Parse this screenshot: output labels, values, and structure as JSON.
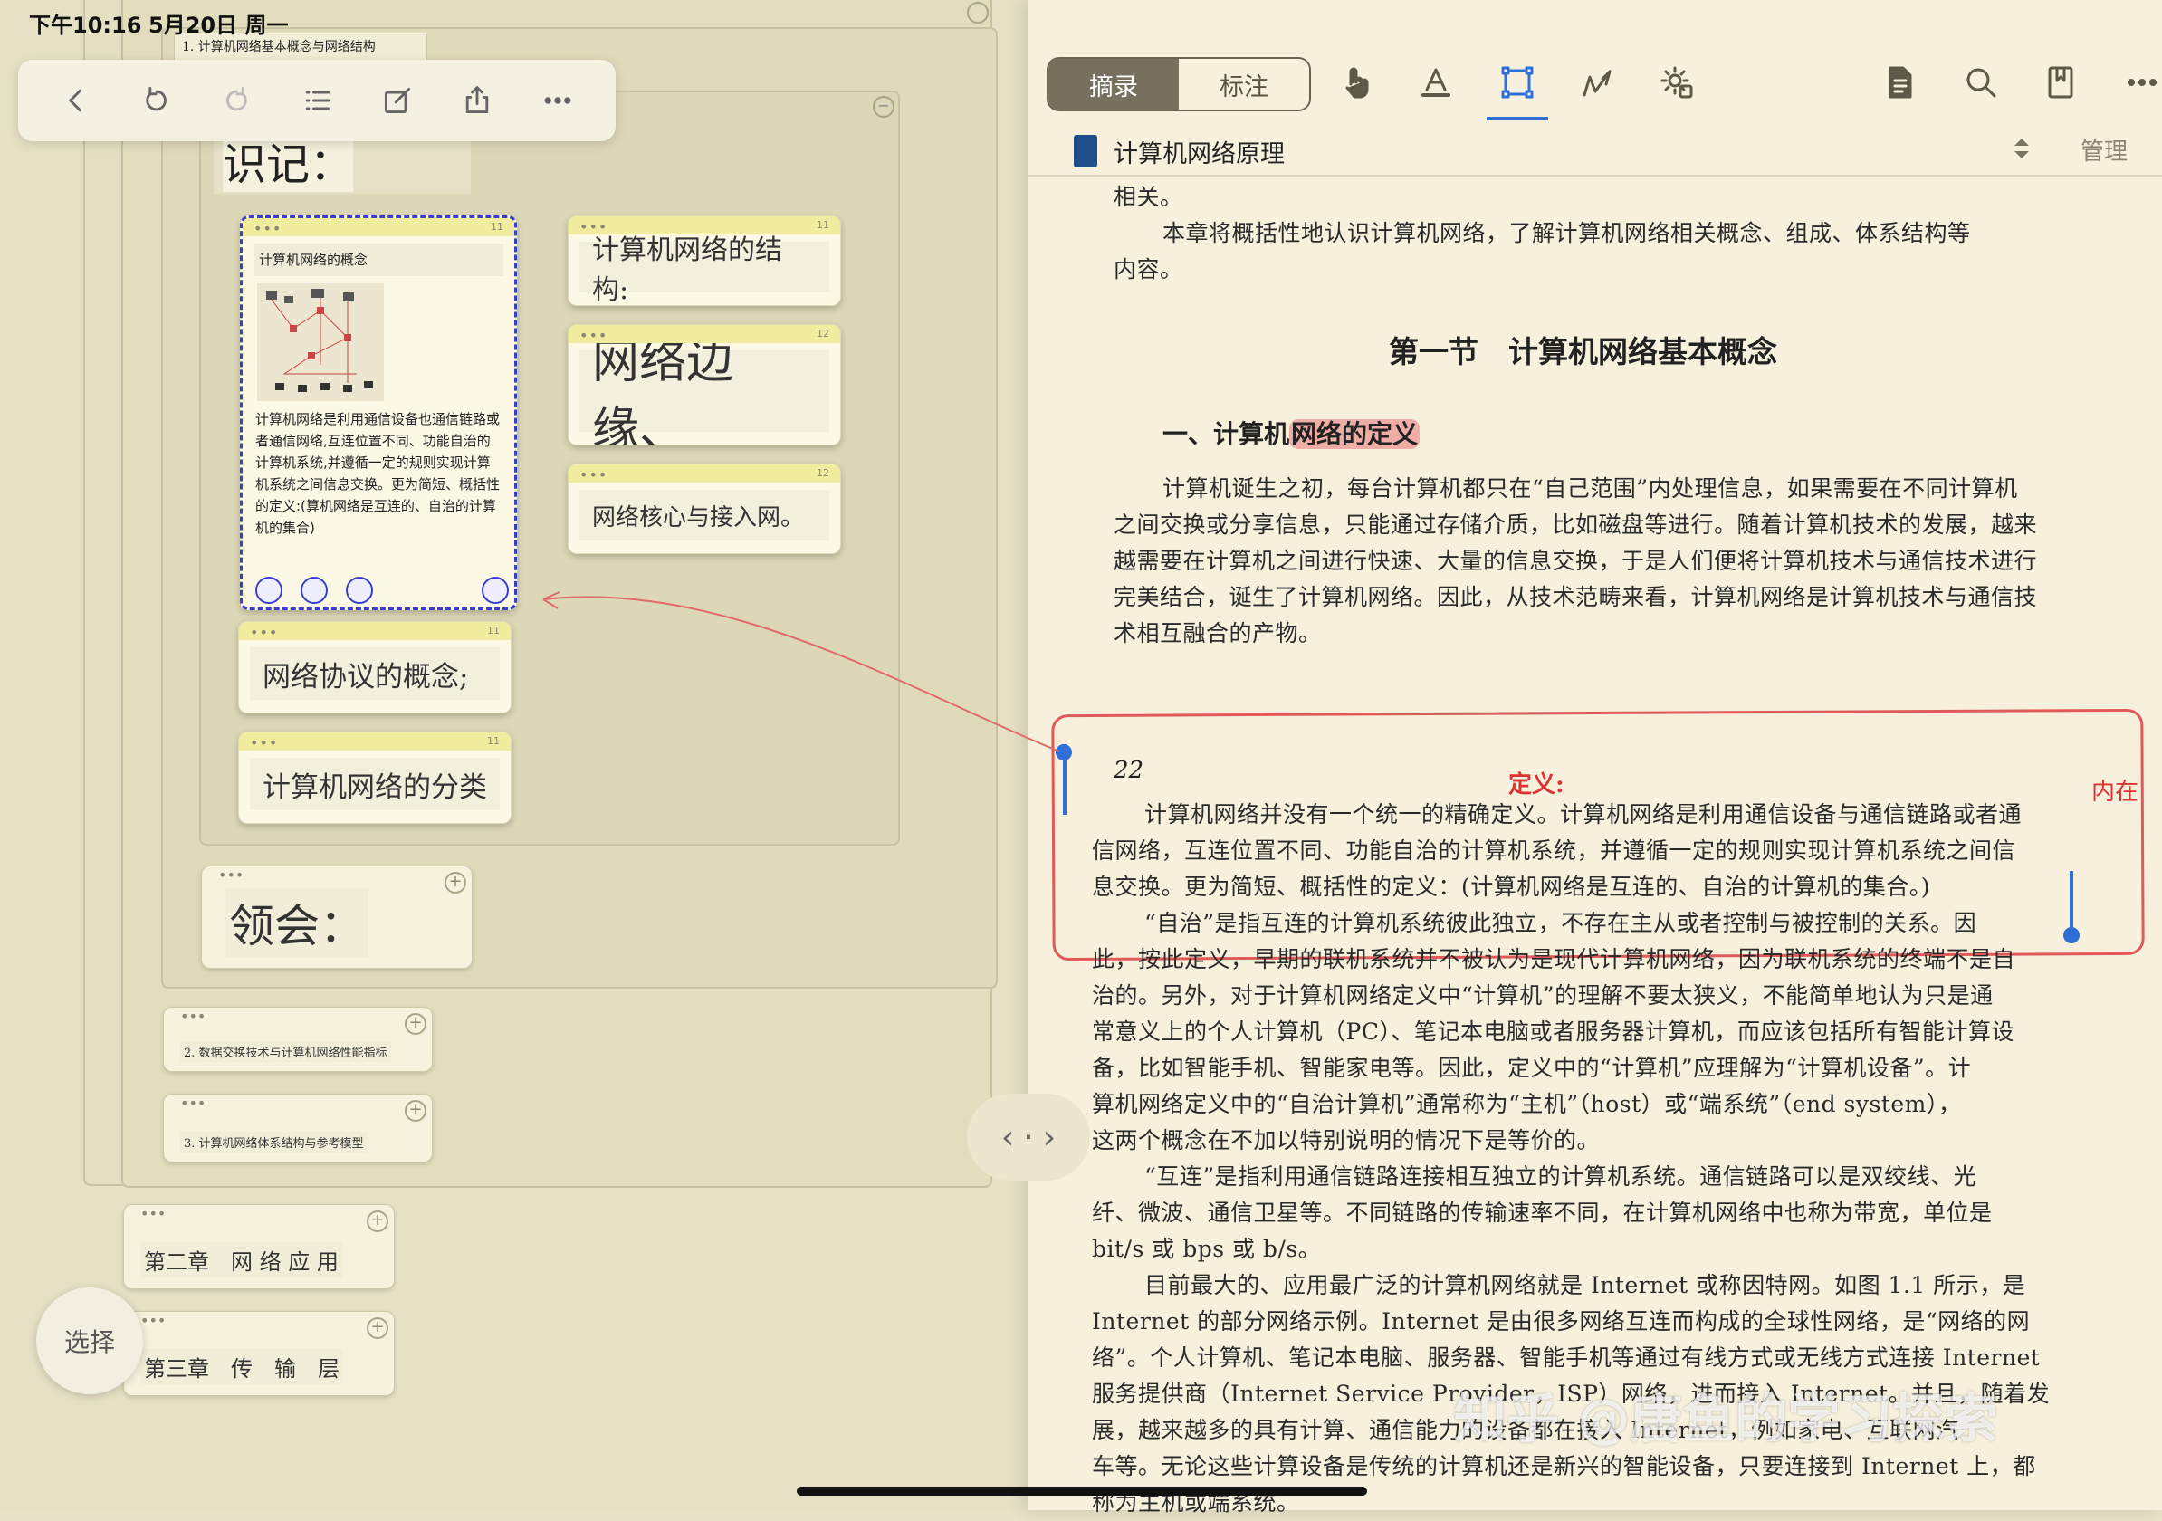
{
  "status_bar": {
    "time": "下午10:16",
    "date": "5月20日 周一"
  },
  "left": {
    "top_node": "1. 计算机网络基本概念与网络结构",
    "shiji_label": "识记：",
    "lingui_label": "领会：",
    "cards": {
      "concept": {
        "title": "计算机网络的概念",
        "count": "11",
        "body": "计算机网络是利用通信设备也通信链路或者通信网络,互连位置不同、功能自治的计算机系统,并遵循一定的规则实现计算机系统之间信息交换。更为简短、概括性的定义:(算机网络是互连的、自治的计算机的集合)"
      },
      "structure": {
        "text": "计算机网络的结构:",
        "count": "11"
      },
      "edge": {
        "text": "网络边缘、",
        "count": "12"
      },
      "core": {
        "text": "网络核心与接入网。",
        "count": "12"
      },
      "protocol": {
        "text": "网络协议的概念;",
        "count": "11"
      },
      "classify": {
        "text": "计算机网络的分类",
        "count": "11"
      }
    },
    "subnodes": {
      "n2": "2. 数据交换技术与计算机网络性能指标",
      "n3": "3. 计算机网络体系结构与参考模型"
    },
    "chapters": {
      "ch2": "第二章　网 络 应 用",
      "ch3": "第三章　传　输　层"
    },
    "select_button": "选择"
  },
  "right": {
    "segment": {
      "active": "摘录",
      "inactive": "标注"
    },
    "book_title": "计算机网络原理",
    "manage": "管理",
    "p_top1": "相关。",
    "p_top2": "本章将概括性地认识计算机网络，了解计算机网络相关概念、组成、体系结构等",
    "p_top3": "内容。",
    "section_title": "第一节　计算机网络基本概念",
    "sub_title_a": "一、计算机",
    "sub_title_b": "网络的定义",
    "p1": [
      "计算机诞生之初，每台计算机都只在“自己范围”内处理信息，如果需要在不同计算机",
      "之间交换或分享信息，只能通过存储介质，比如磁盘等进行。随着计算机技术的发展，越来",
      "越需要在计算机之间进行快速、大量的信息交换，于是人们便将计算机技术与通信技术进行",
      "完美结合，诞生了计算机网络。因此，从技术范畴来看，计算机网络是计算机技术与通信技",
      "术相互融合的产物。"
    ],
    "page_num": "22",
    "note_def": "定义:",
    "note_side": "内在",
    "def_lines": [
      "计算机网络并没有一个统一的精确定义。计算机网络是利用通信设备与通信链路或者通",
      "信网络，互连位置不同、功能自治的计算机系统，并遵循一定的规则实现计算机系统之间信",
      "息交换。更为简短、概括性的定义：(计算机网络是互连的、自治的计算机的集合。)"
    ],
    "p2": [
      "“自治”是指互连的计算机系统彼此独立，不存在主从或者控制与被控制的关系。因",
      "此，按此定义，早期的联机系统并不被认为是现代计算机网络，因为联机系统的终端不是自",
      "治的。另外，对于计算机网络定义中“计算机”的理解不要太狭义，不能简单地认为只是通",
      "常意义上的个人计算机（PC）、笔记本电脑或者服务器计算机，而应该包括所有智能计算设",
      "备，比如智能手机、智能家电等。因此，定义中的“计算机”应理解为“计算机设备”。计",
      "算机网络定义中的“自治计算机”通常称为“主机”（host）或“端系统”（end system），",
      "这两个概念在不加以特别说明的情况下是等价的。",
      "“互连”是指利用通信链路连接相互独立的计算机系统。通信链路可以是双绞线、光",
      "纤、微波、通信卫星等。不同链路的传输速率不同，在计算机网络中也称为带宽，单位是",
      "bit/s 或 bps 或 b/s。",
      "目前最大的、应用最广泛的计算机网络就是 Internet 或称因特网。如图 1.1 所示，是",
      "Internet 的部分网络示例。Internet 是由很多网络互连而构成的全球性网络，是“网络的网",
      "络”。个人计算机、笔记本电脑、服务器、智能手机等通过有线方式或无线方式连接 Internet",
      "服务提供商（Internet Service Provider，ISP）网络，进而接入 Internet。并且，随着发",
      "展，越来越多的具有计算、通信能力的设备都在接入 Internet，例如家电、互联网汽",
      "车等。无论这些计算设备是传统的计算机还是新兴的智能设备，只要连接到 Internet 上，都",
      "称为主机或端系统。"
    ],
    "watermark": "知乎 @唐鱼的学习探索"
  }
}
